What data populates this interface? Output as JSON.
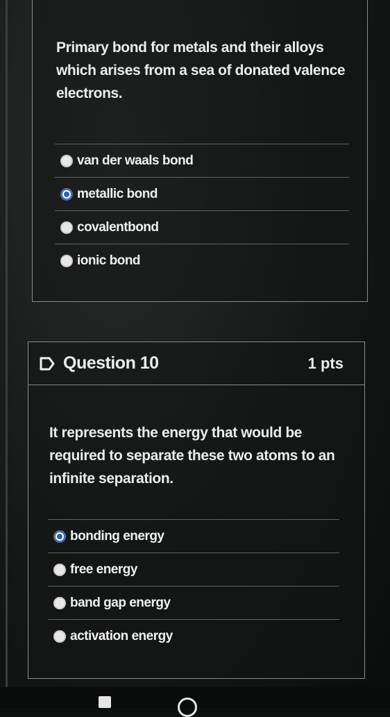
{
  "question9": {
    "stem": "Primary bond for metals and their alloys which arises from a sea of donated valence electrons.",
    "options": [
      {
        "label": "van der waals bond",
        "selected": false
      },
      {
        "label": "metallic bond",
        "selected": true
      },
      {
        "label": "covalentbond",
        "selected": false
      },
      {
        "label": "ionic bond",
        "selected": false
      }
    ]
  },
  "question10": {
    "title": "Question 10",
    "points": "1 pts",
    "stem": "It represents the energy that would be required to separate these two atoms to an infinite separation.",
    "options": [
      {
        "label": "bonding energy",
        "selected": true
      },
      {
        "label": "free energy",
        "selected": false
      },
      {
        "label": "band gap energy",
        "selected": false
      },
      {
        "label": "activation energy",
        "selected": false
      }
    ]
  },
  "colors": {
    "selected_radio": "#2d5fb3",
    "border": "#8a8d8d",
    "background": "#0e1010"
  },
  "icons": {
    "flag": "flag-outline-icon"
  }
}
